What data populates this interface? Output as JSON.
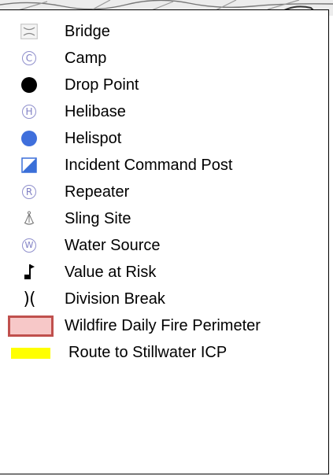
{
  "legend": {
    "items": [
      {
        "label": "Bridge",
        "icon": "bridge-icon"
      },
      {
        "label": "Camp",
        "icon": "camp-icon",
        "glyph": "C"
      },
      {
        "label": "Drop Point",
        "icon": "drop-point-icon"
      },
      {
        "label": "Helibase",
        "icon": "helibase-icon",
        "glyph": "H"
      },
      {
        "label": "Helispot",
        "icon": "helispot-icon"
      },
      {
        "label": "Incident Command Post",
        "icon": "incident-command-post-icon"
      },
      {
        "label": "Repeater",
        "icon": "repeater-icon",
        "glyph": "R"
      },
      {
        "label": "Sling Site",
        "icon": "sling-site-icon"
      },
      {
        "label": "Water Source",
        "icon": "water-source-icon",
        "glyph": "W"
      },
      {
        "label": "Value at Risk",
        "icon": "value-at-risk-icon"
      },
      {
        "label": "Division Break",
        "icon": "division-break-icon",
        "glyph": ")("
      },
      {
        "label": "Wildfire Daily Fire Perimeter",
        "icon": "fire-perimeter-swatch"
      },
      {
        "label": "Route to Stillwater ICP",
        "icon": "route-swatch"
      }
    ]
  },
  "colors": {
    "drop_point": "#000000",
    "helispot": "#3f6fdc",
    "command_post": "#3a6fd8",
    "symbol_outline": "#8f8fcc",
    "perimeter_fill": "#f7c8c8",
    "perimeter_border": "#c0504d",
    "route": "#ffff00"
  }
}
